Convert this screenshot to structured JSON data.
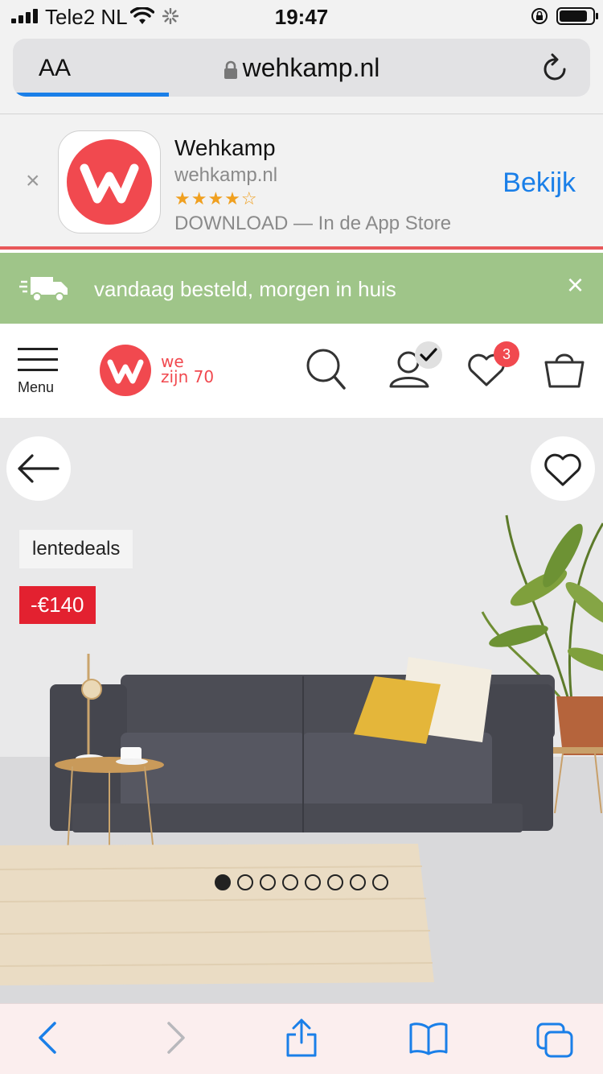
{
  "status_bar": {
    "carrier": "Tele2 NL",
    "time": "19:47"
  },
  "browser": {
    "aa_label": "AA",
    "url": "wehkamp.nl",
    "load_progress": 0.27
  },
  "app_banner": {
    "app_name": "Wehkamp",
    "app_domain": "wehkamp.nl",
    "rating_stars": "★★★★☆",
    "rating": 4.5,
    "download_text": "DOWNLOAD — In de App Store",
    "open_label": "Bekijk",
    "close_label": "×"
  },
  "delivery_banner": {
    "text": "vandaag besteld, morgen in huis",
    "close_label": "×"
  },
  "header": {
    "menu_label": "Menu",
    "tagline_line1": "we",
    "tagline_line2": "zijn 70",
    "wishlist_count": "3"
  },
  "product": {
    "promo_tag": "lentedeals",
    "discount": "-€140",
    "carousel_total": 8,
    "carousel_active": 1
  },
  "colors": {
    "brand": "#f1494f",
    "delivery_green": "#9fc589",
    "ios_blue": "#1a7fe8",
    "discount_red": "#e32130"
  }
}
